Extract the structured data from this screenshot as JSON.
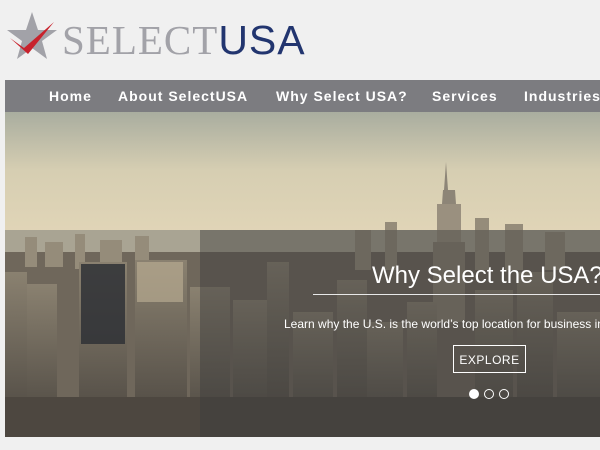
{
  "logo": {
    "select": "SELECT",
    "usa": "USA",
    "star_color": "#a2a2a8",
    "swoosh_color": "#c8222c",
    "usa_color": "#22356f"
  },
  "nav": {
    "items": [
      {
        "label": "Home"
      },
      {
        "label": "About SelectUSA"
      },
      {
        "label": "Why Select USA?"
      },
      {
        "label": "Services"
      },
      {
        "label": "Industries"
      }
    ]
  },
  "hero": {
    "title": "Why Select the USA?",
    "subtitle": "Learn why the U.S. is the world’s top location for business investment.",
    "button_label": "EXPLORE",
    "slides_total": 3,
    "active_slide": 1
  }
}
